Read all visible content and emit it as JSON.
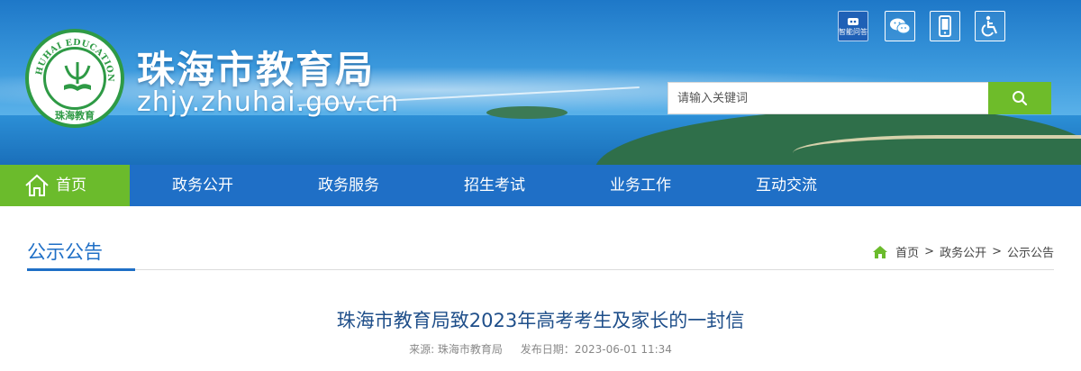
{
  "header": {
    "site_title": "珠海市教育局",
    "site_domain": "zhjy.zhuhai.gov.cn",
    "logo": {
      "ring_text": "ZHUHAI EDUCATION",
      "cn_text": "珠海教育",
      "brand_color": "#2e9a45"
    },
    "tools": {
      "smart_qa_label": "智能问答",
      "wechat_icon": "wechat-icon",
      "mobile_icon": "mobile-phone-icon",
      "accessibility_icon": "wheelchair-icon"
    },
    "search": {
      "placeholder": "请输入关键词",
      "button_color": "#6ebc2a"
    }
  },
  "nav": {
    "items": [
      {
        "label": "首页",
        "active": true
      },
      {
        "label": "政务公开"
      },
      {
        "label": "政务服务"
      },
      {
        "label": "招生考试"
      },
      {
        "label": "业务工作"
      },
      {
        "label": "互动交流"
      }
    ],
    "bar_color": "#1f6fc6",
    "active_color": "#6bbb2c"
  },
  "section": {
    "title": "公示公告",
    "breadcrumb": [
      "首页",
      "政务公开",
      "公示公告"
    ],
    "separator": ">"
  },
  "article": {
    "title": "珠海市教育局致2023年高考考生及家长的一封信",
    "source": "来源: 珠海市教育局",
    "publish_time": "发布日期：2023-06-01 11:34"
  }
}
